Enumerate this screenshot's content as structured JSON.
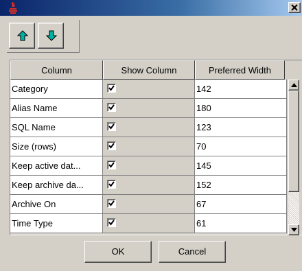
{
  "window": {
    "app_icon": "java-cup-icon",
    "close_icon": "close-icon"
  },
  "toolbar": {
    "move_up_icon": "arrow-up-icon",
    "move_down_icon": "arrow-down-icon",
    "arrow_color": "#00a0a0"
  },
  "table": {
    "headers": [
      "Column",
      "Show Column",
      "Preferred Width"
    ],
    "rows": [
      {
        "column": "Category",
        "show": true,
        "width": "142"
      },
      {
        "column": "Alias Name",
        "show": true,
        "width": "180"
      },
      {
        "column": "SQL Name",
        "show": true,
        "width": "123"
      },
      {
        "column": "Size (rows)",
        "show": true,
        "width": "70"
      },
      {
        "column": "Keep active dat...",
        "show": true,
        "width": "145"
      },
      {
        "column": "Keep archive da...",
        "show": true,
        "width": "152"
      },
      {
        "column": "Archive On",
        "show": true,
        "width": "67"
      },
      {
        "column": "Time Type",
        "show": true,
        "width": "61"
      }
    ]
  },
  "buttons": {
    "ok": "OK",
    "cancel": "Cancel"
  }
}
